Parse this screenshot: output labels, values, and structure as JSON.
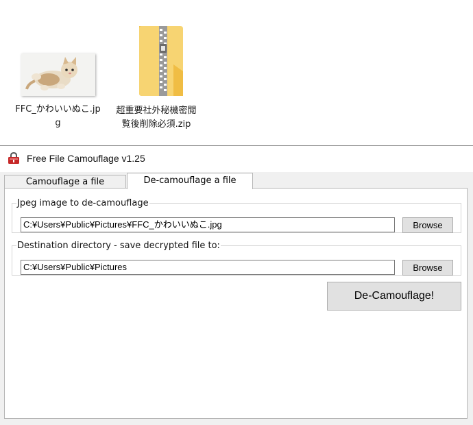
{
  "desktop": {
    "items": [
      {
        "label": "FFC_かわいいぬこ.jpg",
        "icon": "kitten-thumbnail-icon"
      },
      {
        "label": "超重要社外秘機密閲覧後削除必須.zip",
        "icon": "zip-folder-icon"
      }
    ]
  },
  "window": {
    "title": "Free File Camouflage v1.25",
    "icon": "lock-icon",
    "tabs": [
      {
        "label": "Camouflage a file",
        "active": false
      },
      {
        "label": "De-camouflage a file",
        "active": true
      }
    ],
    "decamouflage": {
      "source_legend": "Jpeg image to de-camouflage",
      "source_path": "C:¥Users¥Public¥Pictures¥FFC_かわいいぬこ.jpg",
      "source_browse": "Browse",
      "dest_legend": "Destination directory - save decrypted file to:",
      "dest_path": "C:¥Users¥Public¥Pictures",
      "dest_browse": "Browse",
      "action_label": "De-Camouflage!"
    }
  },
  "colors": {
    "folder": "#f7cc5b",
    "lock_red": "#c62828",
    "button_face": "#e1e1e1"
  }
}
